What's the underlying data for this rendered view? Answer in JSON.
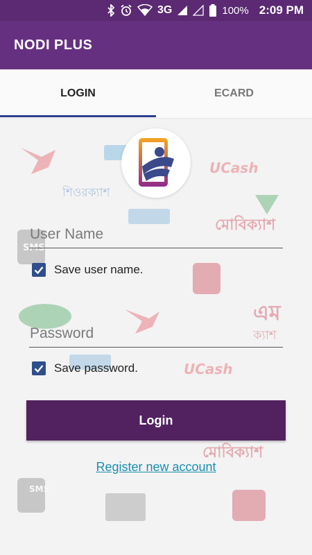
{
  "status_bar": {
    "network": "3G",
    "battery": "100%",
    "time": "2:09 PM",
    "icons": [
      "bluetooth-icon",
      "alarm-icon",
      "wifi-icon",
      "signal-icon",
      "battery-icon"
    ]
  },
  "app_bar": {
    "title": "NODI PLUS"
  },
  "tabs": [
    {
      "label": "LOGIN",
      "active": true
    },
    {
      "label": "ECARD",
      "active": false
    }
  ],
  "watermarks": [
    "শিওরক্যাশ",
    "UCash",
    "মোবিক্যাশ",
    "SMS",
    "এম",
    "ক্যাশ",
    "UCash",
    "মোবিক্যাশ",
    "SMS"
  ],
  "form": {
    "username_placeholder": "User Name",
    "save_username_label": "Save user name.",
    "save_username_checked": true,
    "password_placeholder": "Password",
    "save_password_label": "Save password.",
    "save_password_checked": true,
    "login_label": "Login",
    "register_label": "Register new account"
  },
  "colors": {
    "status_bar": "#5b2a73",
    "app_bar": "#663080",
    "primary_button": "#52215f",
    "tab_indicator": "#2a3f8f",
    "checkbox": "#2f4e8c",
    "link": "#1a8fb0"
  }
}
